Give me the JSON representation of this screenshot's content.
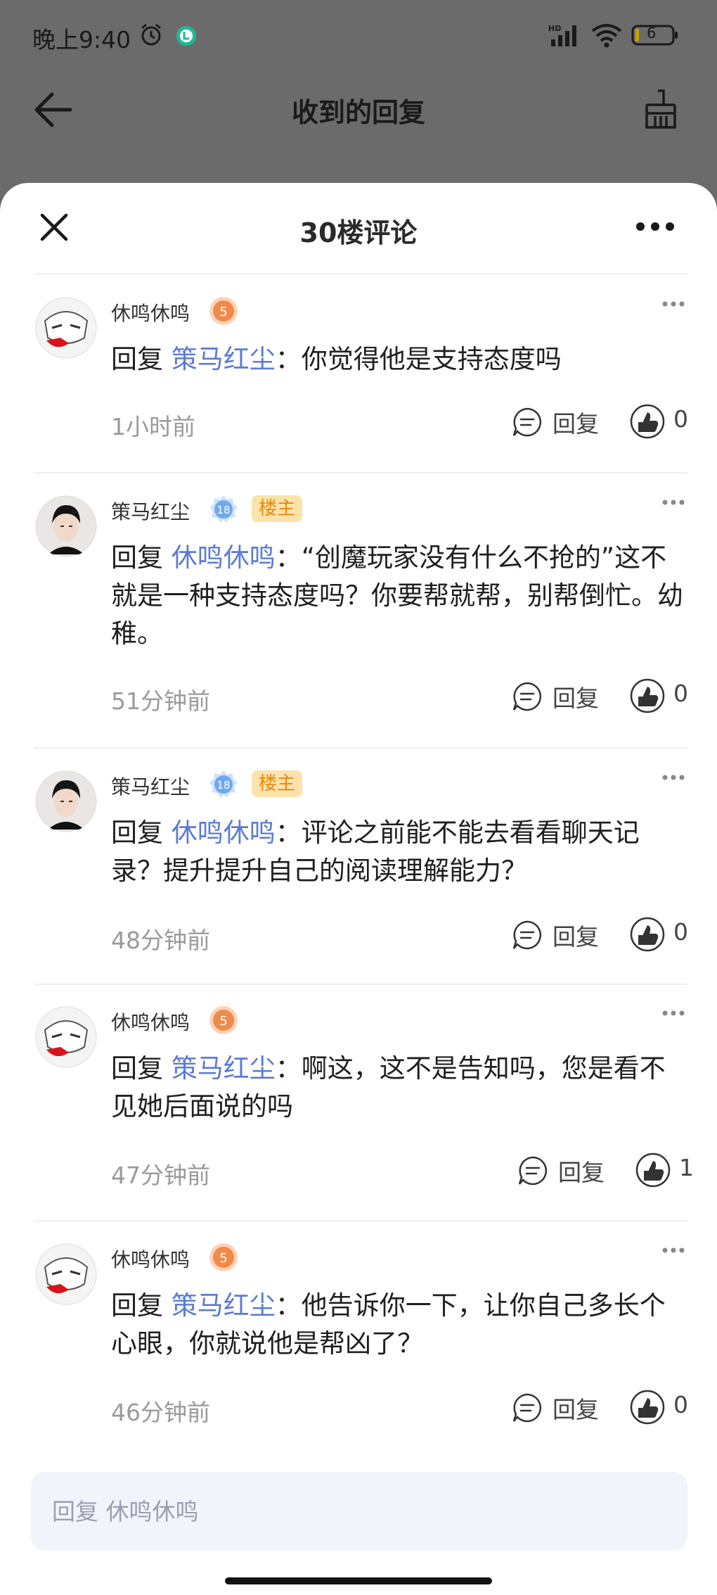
{
  "statusbar": {
    "time": "晚上9:40",
    "battery": "6",
    "icons": [
      "alarm-icon",
      "app-notification-icon",
      "hd-signal-icon",
      "wifi-icon",
      "battery-icon"
    ]
  },
  "topbar": {
    "title": "收到的回复",
    "icons": [
      "back-arrow-icon",
      "broom-icon"
    ]
  },
  "sheet": {
    "title": "30楼评论",
    "icons": [
      "close-icon",
      "more-icon"
    ]
  },
  "comments": [
    {
      "user": "休鸣休鸣",
      "level": "5",
      "owner_badge": "",
      "reply_prefix": "回复",
      "reply_to": "策马红尘",
      "text": "：你觉得他是支持态度吗",
      "time": "1小时前",
      "reply_label": "回复",
      "likes": "0"
    },
    {
      "user": "策马红尘",
      "level": "18",
      "owner_badge": "楼主",
      "reply_prefix": "回复",
      "reply_to": "休鸣休鸣",
      "text": "：“创魔玩家没有什么不抢的”这不就是一种支持态度吗？你要帮就帮，别帮倒忙。幼稚。",
      "time": "51分钟前",
      "reply_label": "回复",
      "likes": "0"
    },
    {
      "user": "策马红尘",
      "level": "18",
      "owner_badge": "楼主",
      "reply_prefix": "回复",
      "reply_to": "休鸣休鸣",
      "text": "：评论之前能不能去看看聊天记录？提升提升自己的阅读理解能力？",
      "time": "48分钟前",
      "reply_label": "回复",
      "likes": "0"
    },
    {
      "user": "休鸣休鸣",
      "level": "5",
      "owner_badge": "",
      "reply_prefix": "回复",
      "reply_to": "策马红尘",
      "text": "：啊这，这不是告知吗，您是看不见她后面说的吗",
      "time": "47分钟前",
      "reply_label": "回复",
      "likes": "1"
    },
    {
      "user": "休鸣休鸣",
      "level": "5",
      "owner_badge": "",
      "reply_prefix": "回复",
      "reply_to": "策马红尘",
      "text": "：他告诉你一下，让你自己多长个心眼，你就说他是帮凶了？",
      "time": "46分钟前",
      "reply_label": "回复",
      "likes": "0"
    }
  ],
  "reply_input": {
    "placeholder": "回复 休鸣休鸣"
  },
  "colors": {
    "mention": "#5b7bd5",
    "owner_badge_bg": "#fde3ab",
    "owner_badge_text": "#e58a0f",
    "level5": "#f08a4b",
    "level18": "#6fa8f0"
  }
}
